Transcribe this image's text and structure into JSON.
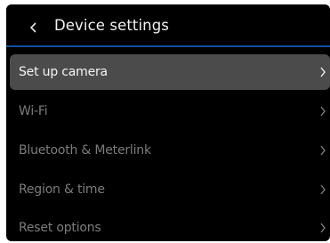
{
  "header": {
    "back_icon": "chevron-left-icon",
    "title": "Device settings"
  },
  "colors": {
    "background": "#000000",
    "accent_line": "#0e4f9a",
    "selected_row": "#4b4b4b",
    "selected_text": "#f4f4f4",
    "unselected_text": "#7c7c7c"
  },
  "menu": {
    "items": [
      {
        "label": "Set up camera",
        "selected": true,
        "icon": "chevron-right-icon"
      },
      {
        "label": "Wi-Fi",
        "selected": false,
        "icon": "chevron-right-icon"
      },
      {
        "label": "Bluetooth & Meterlink",
        "selected": false,
        "icon": "chevron-right-icon"
      },
      {
        "label": "Region & time",
        "selected": false,
        "icon": "chevron-right-icon"
      },
      {
        "label": "Reset options",
        "selected": false,
        "icon": "chevron-right-icon"
      }
    ]
  }
}
